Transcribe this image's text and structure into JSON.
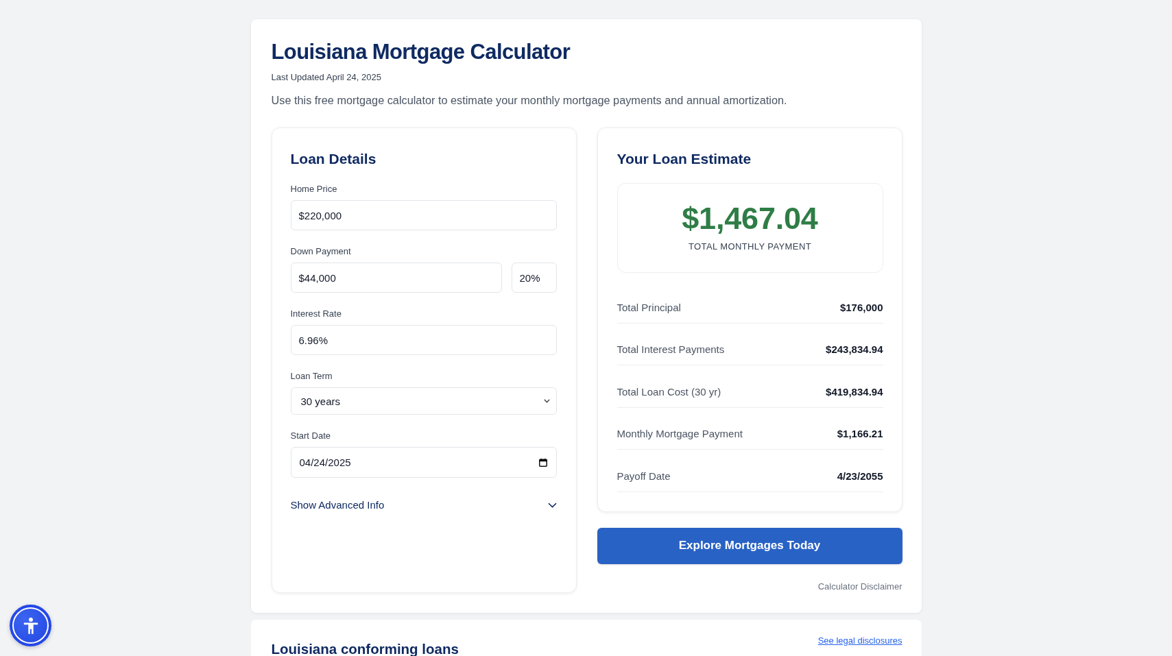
{
  "header": {
    "title": "Louisiana Mortgage Calculator",
    "updated": "Last Updated April 24, 2025",
    "description": "Use this free mortgage calculator to estimate your monthly mortgage payments and annual amortization."
  },
  "loan_details": {
    "title": "Loan Details",
    "fields": [
      {
        "kind": "text",
        "label": "Home Price",
        "inputs": [
          "$220,000"
        ]
      },
      {
        "kind": "text",
        "label": "Down Payment",
        "inputs": [
          "$44,000",
          "20%"
        ]
      },
      {
        "kind": "text",
        "label": "Interest Rate",
        "inputs": [
          "6.96%"
        ]
      },
      {
        "kind": "select",
        "label": "Loan Term",
        "value": "30 years"
      },
      {
        "kind": "date",
        "label": "Start Date",
        "value": "04/24/2025"
      }
    ],
    "advanced": {
      "label": "Show Advanced Info",
      "expanded": false
    }
  },
  "estimate": {
    "title": "Your Loan Estimate",
    "total_amount": "$1,467.04",
    "total_label": "TOTAL MONTHLY PAYMENT",
    "rows": [
      {
        "label": "Total Principal",
        "value": "$176,000"
      },
      {
        "label": "Total Interest Payments",
        "value": "$243,834.94"
      },
      {
        "label": "Total Loan Cost (30 yr)",
        "value": "$419,834.94"
      },
      {
        "label": "Monthly Mortgage Payment",
        "value": "$1,166.21"
      },
      {
        "label": "Payoff Date",
        "value": "4/23/2055"
      }
    ]
  },
  "cta": {
    "button": "Explore Mortgages Today",
    "disclaimer": "Calculator Disclaimer"
  },
  "next_section": {
    "title": "Louisiana conforming loans",
    "link": "See legal disclosures"
  }
}
